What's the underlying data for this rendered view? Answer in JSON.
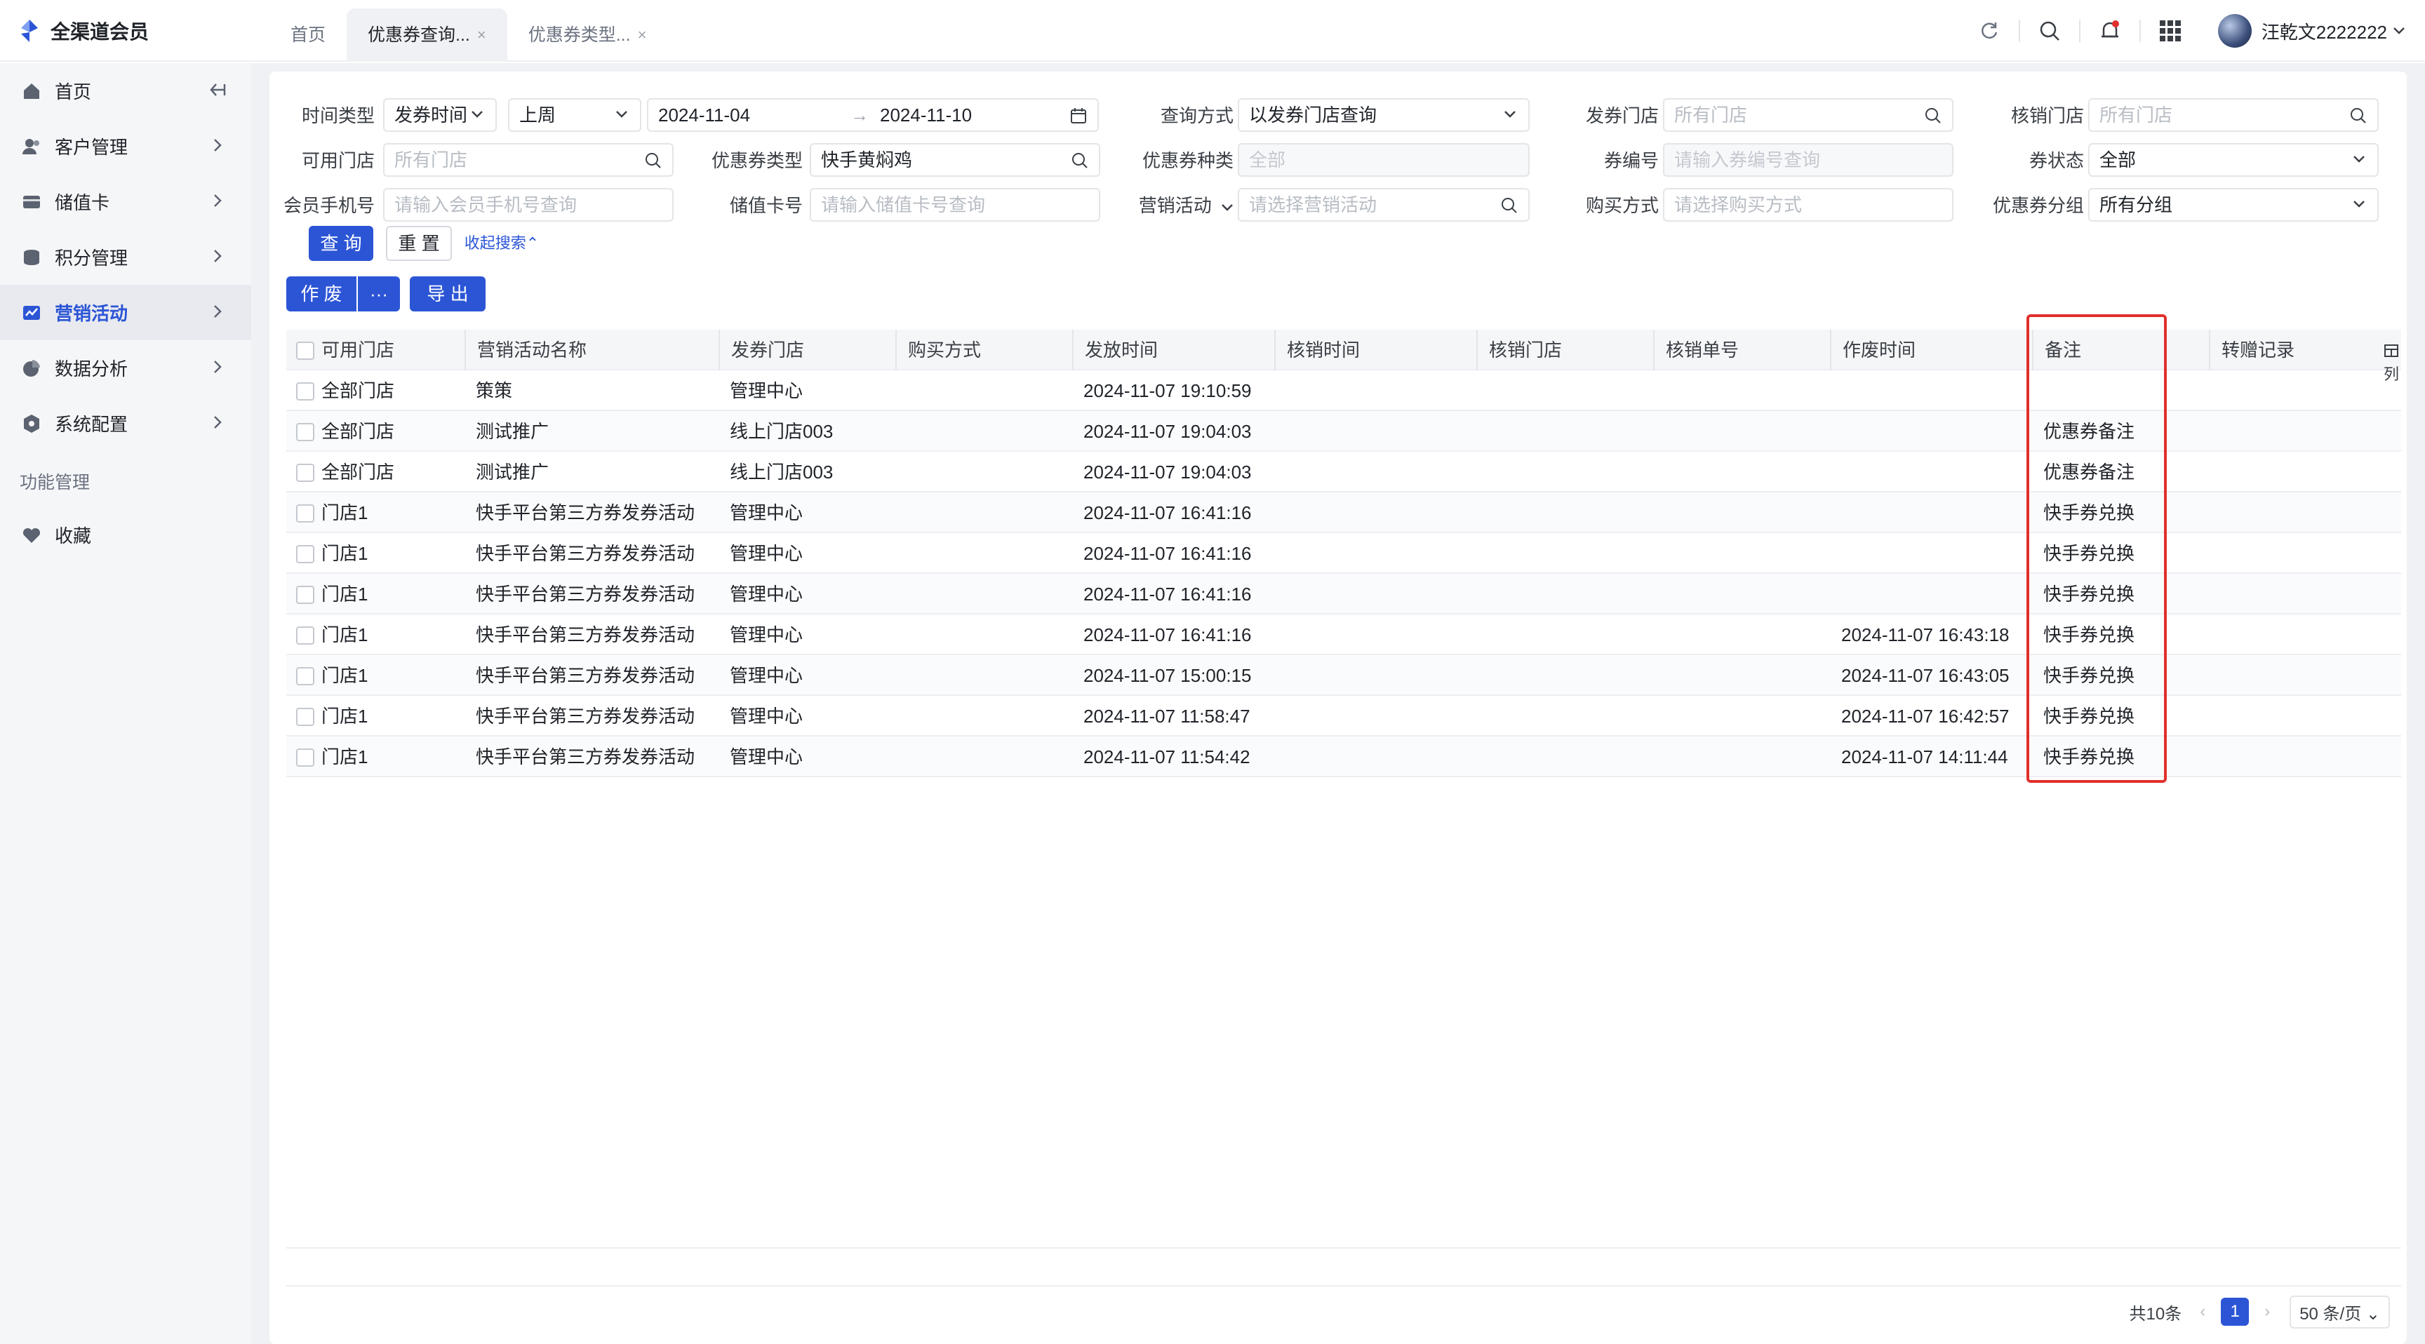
{
  "app": {
    "title": "全渠道会员"
  },
  "tabs": [
    {
      "label": "首页"
    },
    {
      "label": "优惠券查询..."
    },
    {
      "label": "优惠券类型..."
    }
  ],
  "user": {
    "name": "汪乾文2222222"
  },
  "sidebar": {
    "items": [
      {
        "label": "首页"
      },
      {
        "label": "客户管理"
      },
      {
        "label": "储值卡"
      },
      {
        "label": "积分管理"
      },
      {
        "label": "营销活动"
      },
      {
        "label": "数据分析"
      },
      {
        "label": "系统配置"
      }
    ],
    "group_label": "功能管理",
    "favorites": "收藏"
  },
  "filters": {
    "time_type_label": "时间类型",
    "time_type_value": "发券时间",
    "period_value": "上周",
    "date_start": "2024-11-04",
    "date_end": "2024-11-10",
    "query_mode_label": "查询方式",
    "query_mode_value": "以发券门店查询",
    "issue_store_label": "发券门店",
    "issue_store_ph": "所有门店",
    "verify_store_label": "核销门店",
    "verify_store_ph": "所有门店",
    "avail_store_label": "可用门店",
    "avail_store_ph": "所有门店",
    "coupon_type_label": "优惠券类型",
    "coupon_type_value": "快手黄焖鸡",
    "coupon_kind_label": "优惠券种类",
    "coupon_kind_value": "全部",
    "coupon_no_label": "券编号",
    "coupon_no_ph": "请输入券编号查询",
    "coupon_status_label": "券状态",
    "coupon_status_value": "全部",
    "phone_label": "会员手机号",
    "phone_ph": "请输入会员手机号查询",
    "card_label": "储值卡号",
    "card_ph": "请输入储值卡号查询",
    "campaign_label": "营销活动",
    "campaign_ph": "请选择营销活动",
    "buy_label": "购买方式",
    "buy_ph": "请选择购买方式",
    "group_label": "优惠券分组",
    "group_value": "所有分组"
  },
  "actions": {
    "query": "查 询",
    "reset": "重 置",
    "collapse": "收起搜索",
    "void": "作 废",
    "more": "···",
    "export": "导 出"
  },
  "table": {
    "columns": [
      "可用门店",
      "营销活动名称",
      "发券门店",
      "购买方式",
      "发放时间",
      "核销时间",
      "核销门店",
      "核销单号",
      "作废时间",
      "备注",
      "转赠记录"
    ],
    "col_setting": "列",
    "rows": [
      {
        "store": "全部门店",
        "campaign": "策策",
        "issue": "管理中心",
        "buy": "",
        "time": "2024-11-07 19:10:59",
        "vtime": "",
        "vstore": "",
        "vno": "",
        "void": "",
        "note": "",
        "transfer": ""
      },
      {
        "store": "全部门店",
        "campaign": "测试推广",
        "issue": "线上门店003",
        "buy": "",
        "time": "2024-11-07 19:04:03",
        "vtime": "",
        "vstore": "",
        "vno": "",
        "void": "",
        "note": "优惠券备注",
        "transfer": ""
      },
      {
        "store": "全部门店",
        "campaign": "测试推广",
        "issue": "线上门店003",
        "buy": "",
        "time": "2024-11-07 19:04:03",
        "vtime": "",
        "vstore": "",
        "vno": "",
        "void": "",
        "note": "优惠券备注",
        "transfer": ""
      },
      {
        "store": "门店1",
        "campaign": "快手平台第三方券发券活动",
        "issue": "管理中心",
        "buy": "",
        "time": "2024-11-07 16:41:16",
        "vtime": "",
        "vstore": "",
        "vno": "",
        "void": "",
        "note": "快手券兑换",
        "transfer": ""
      },
      {
        "store": "门店1",
        "campaign": "快手平台第三方券发券活动",
        "issue": "管理中心",
        "buy": "",
        "time": "2024-11-07 16:41:16",
        "vtime": "",
        "vstore": "",
        "vno": "",
        "void": "",
        "note": "快手券兑换",
        "transfer": ""
      },
      {
        "store": "门店1",
        "campaign": "快手平台第三方券发券活动",
        "issue": "管理中心",
        "buy": "",
        "time": "2024-11-07 16:41:16",
        "vtime": "",
        "vstore": "",
        "vno": "",
        "void": "",
        "note": "快手券兑换",
        "transfer": ""
      },
      {
        "store": "门店1",
        "campaign": "快手平台第三方券发券活动",
        "issue": "管理中心",
        "buy": "",
        "time": "2024-11-07 16:41:16",
        "vtime": "",
        "vstore": "",
        "vno": "",
        "void": "2024-11-07 16:43:18",
        "note": "快手券兑换",
        "transfer": ""
      },
      {
        "store": "门店1",
        "campaign": "快手平台第三方券发券活动",
        "issue": "管理中心",
        "buy": "",
        "time": "2024-11-07 15:00:15",
        "vtime": "",
        "vstore": "",
        "vno": "",
        "void": "2024-11-07 16:43:05",
        "note": "快手券兑换",
        "transfer": ""
      },
      {
        "store": "门店1",
        "campaign": "快手平台第三方券发券活动",
        "issue": "管理中心",
        "buy": "",
        "time": "2024-11-07 11:58:47",
        "vtime": "",
        "vstore": "",
        "vno": "",
        "void": "2024-11-07 16:42:57",
        "note": "快手券兑换",
        "transfer": ""
      },
      {
        "store": "门店1",
        "campaign": "快手平台第三方券发券活动",
        "issue": "管理中心",
        "buy": "",
        "time": "2024-11-07 11:54:42",
        "vtime": "",
        "vstore": "",
        "vno": "",
        "void": "2024-11-07 14:11:44",
        "note": "快手券兑换",
        "transfer": ""
      }
    ]
  },
  "pagination": {
    "total": "共10条",
    "page": "1",
    "size": "50 条/页"
  }
}
